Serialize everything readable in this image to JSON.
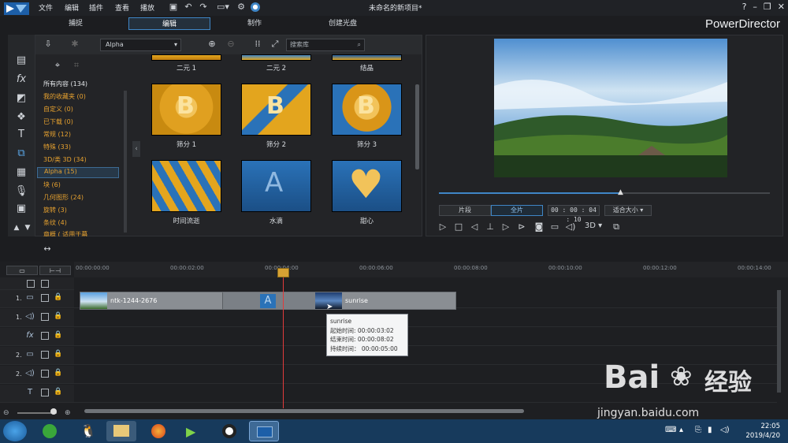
{
  "menu": {
    "file": "文件",
    "edit": "编辑",
    "plugins": "插件",
    "view": "查看",
    "play": "播放"
  },
  "window": {
    "title": "未命名的新项目*",
    "brand": "PowerDirector"
  },
  "modes": [
    "捕捉",
    "编辑",
    "制作",
    "创建光盘"
  ],
  "library": {
    "filter": "Alpha",
    "search_placeholder": "搜索库",
    "categories": [
      {
        "label": "所有内容 (134)"
      },
      {
        "label": "我的收藏夹 (0)"
      },
      {
        "label": "自定义 (0)"
      },
      {
        "label": "已下载 (0)"
      },
      {
        "label": "常规 (12)"
      },
      {
        "label": "特殊 (33)"
      },
      {
        "label": "3D/类 3D (34)"
      },
      {
        "label": "Alpha (15)"
      },
      {
        "label": "块 (6)"
      },
      {
        "label": "几何图形 (24)"
      },
      {
        "label": "旋转 (3)"
      },
      {
        "label": "条纹 (4)"
      },
      {
        "label": "章概 ( 适用于幕"
      }
    ],
    "thumbs": [
      {
        "label": "二元 1"
      },
      {
        "label": "二元 2"
      },
      {
        "label": "结晶"
      },
      {
        "label": "筛分 1"
      },
      {
        "label": "筛分 2"
      },
      {
        "label": "筛分 3"
      },
      {
        "label": "时间流逝"
      },
      {
        "label": "水滴"
      },
      {
        "label": "甜心"
      }
    ]
  },
  "preview": {
    "clip_tab": "片段",
    "movie_tab": "全片",
    "timecode": "00 : 00 : 04 : 10",
    "fit": "适合大小",
    "mode3d": "3D",
    "progress": 0.55
  },
  "timeline": {
    "ticks": [
      "00:00:00:00",
      "00:00:02:00",
      "00:00:04:00",
      "00:00:06:00",
      "00:00:08:00",
      "00:00:10:00",
      "00:00:12:00",
      "00:00:14:00"
    ],
    "tracks": [
      {
        "label": "1."
      },
      {
        "label": "1."
      },
      {
        "label": ""
      },
      {
        "label": "2."
      },
      {
        "label": "2."
      },
      {
        "label": ""
      }
    ],
    "clip1": "ntk-1244-2676",
    "clip2": "sunrise",
    "tooltip": {
      "name": "sunrise",
      "start": "起始时间: 00:00:03:02",
      "end": "结束时间: 00:00:08:02",
      "dur": "持续时间： 00:00:05:00"
    }
  },
  "taskbar": {
    "time": "22:05",
    "date": "2019/4/20"
  },
  "watermark": {
    "brand": "Bai",
    "brand2": "经验",
    "url": "jingyan.baidu.com"
  }
}
